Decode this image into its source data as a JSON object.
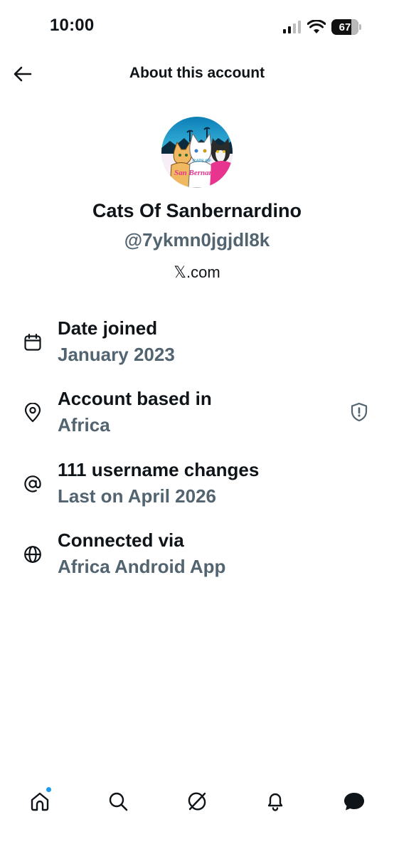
{
  "status_bar": {
    "time": "10:00",
    "battery_level": "67",
    "icons": [
      "signal-icon",
      "wifi-icon",
      "battery-icon"
    ]
  },
  "header": {
    "title": "About this account",
    "back_icon": "arrow-left-icon"
  },
  "profile": {
    "avatar_text_top": "CATS OF",
    "avatar_text_script": "San Bernardino",
    "display_name": "Cats Of Sanbernardino",
    "handle": "@7ykmn0jgjdl8k",
    "domain": "𝕏.com"
  },
  "details": [
    {
      "icon": "calendar-icon",
      "title": "Date joined",
      "value": "January 2023"
    },
    {
      "icon": "location-pin-icon",
      "title": "Account based in",
      "value": "Africa",
      "badge_icon": "shield-alert-icon"
    },
    {
      "icon": "at-sign-icon",
      "title": "111 username changes",
      "value": "Last on April 2026"
    },
    {
      "icon": "globe-icon",
      "title": "Connected via",
      "value": "Africa Android App"
    }
  ],
  "bottom_nav": [
    "home-icon",
    "search-icon",
    "grok-icon",
    "notifications-bell-icon",
    "messages-icon"
  ],
  "colors": {
    "primary_text": "#0f1419",
    "secondary_text": "#536471",
    "accent_blue": "#1d9bf0",
    "background": "#ffffff"
  }
}
